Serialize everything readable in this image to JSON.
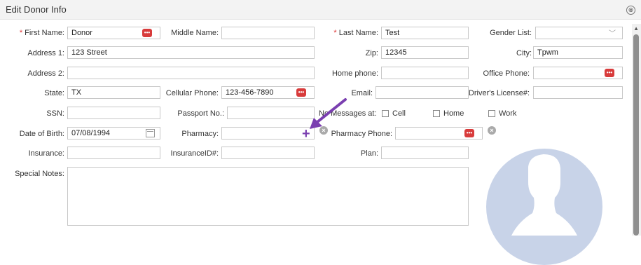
{
  "window": {
    "title": "Edit Donor Info",
    "close_label": "⊗"
  },
  "labels": {
    "first_name": "First Name:",
    "middle_name": "Middle Name:",
    "last_name": "Last Name:",
    "gender": "Gender List:",
    "address1": "Address 1:",
    "zip": "Zip:",
    "city": "City:",
    "address2": "Address 2:",
    "home_phone": "Home phone:",
    "office_phone": "Office Phone:",
    "state": "State:",
    "cellular": "Cellular Phone:",
    "email": "Email:",
    "drivers_license": "Driver's License#:",
    "ssn": "SSN:",
    "passport": "Passport No.:",
    "no_messages": "No Messages at:",
    "cell": "Cell",
    "home": "Home",
    "work": "Work",
    "dob": "Date of Birth:",
    "pharmacy": "Pharmacy:",
    "pharmacy_phone": "Pharmacy Phone:",
    "insurance": "Insurance:",
    "insurance_id": "InsuranceID#:",
    "plan": "Plan:",
    "special_notes": "Special Notes:"
  },
  "values": {
    "first_name": "Donor",
    "middle_name": "",
    "last_name": "Test",
    "gender": "",
    "address1": "123 Street",
    "zip": "12345",
    "city": "Tpwm",
    "address2": "",
    "home_phone": "",
    "office_phone": "",
    "state": "TX",
    "cellular": "123-456-7890",
    "email": "",
    "drivers_license": "",
    "ssn": "",
    "passport": "",
    "dob": "07/08/1994",
    "pharmacy": "",
    "pharmacy_phone": "",
    "insurance": "",
    "insurance_id": "",
    "plan": "",
    "special_notes": ""
  },
  "checkboxes": {
    "cell": false,
    "home": false,
    "work": false
  },
  "icons": {
    "phone_dots": "•••",
    "required": "*",
    "plus": "+",
    "clear": "×",
    "chevron": "﹀",
    "scroll_up": "▲"
  },
  "colors": {
    "accent_red": "#d83b3b",
    "annotation_purple": "#7a3fb0",
    "avatar_bg": "#c8d3e8"
  }
}
